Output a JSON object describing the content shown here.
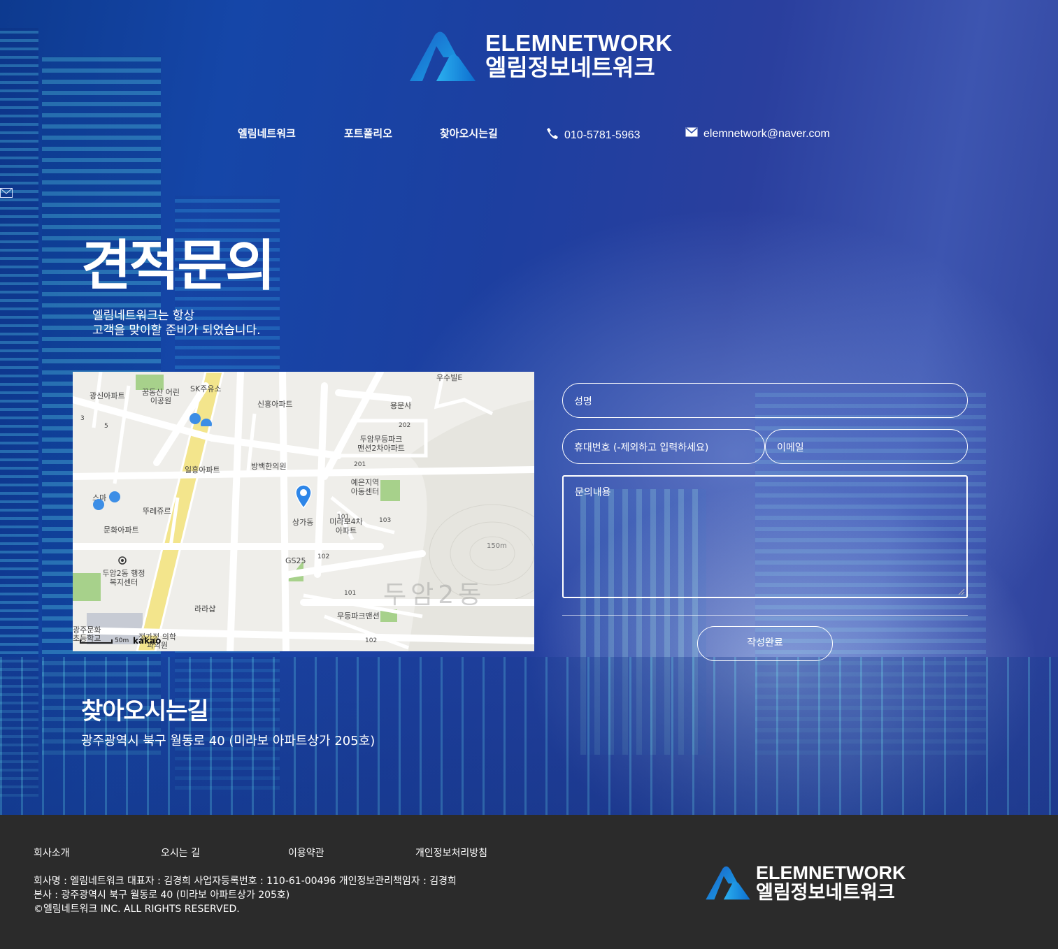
{
  "brand": {
    "name_en": "ELEMNETWORK",
    "name_ko": "엘림정보네트워크"
  },
  "nav": {
    "items": [
      "엘림네트워크",
      "포트폴리오",
      "찾아오시는길"
    ],
    "phone": "010-5781-5963",
    "email": "elemnetwork@naver.com"
  },
  "hero": {
    "title": "견적문의",
    "subtitle_line1": "엘림네트워크는 항상",
    "subtitle_line2": "고객을 맞이할 준비가 되었습니다."
  },
  "map": {
    "labels": [
      "광신아파트",
      "꿈동산 어린이공원",
      "SK주유소",
      "신흥아파트",
      "우수빌E",
      "용문사",
      "두암무등파크 맨션2차아파트",
      "일흥아파트",
      "방백한의원",
      "예은지역 아동센터",
      "상가동",
      "미라보4차 아파트",
      "스마",
      "뚜레쥬르",
      "문화아파트",
      "GS25",
      "두암2동 행정복지센터",
      "라라샵",
      "무등파크맨션",
      "정가정 의학과의원",
      "광주문화 초등학교",
      "150m",
      "50m",
      "kakao"
    ],
    "area_name": "두암2동",
    "numbers": [
      "3",
      "5",
      "202",
      "201",
      "101",
      "103",
      "102",
      "101",
      "102"
    ]
  },
  "form": {
    "name_placeholder": "성명",
    "phone_placeholder": "휴대번호 (-제외하고 입력하세요)",
    "email_placeholder": "이메일",
    "message_placeholder": "문의내용",
    "submit_label": "작성완료"
  },
  "directions": {
    "title": "찾아오시는길",
    "address": "광주광역시 북구 월동로 40 (미라보 아파트상가 205호)"
  },
  "footer": {
    "links": [
      "회사소개",
      "오시는 길",
      "이용약관",
      "개인정보처리방침"
    ],
    "company_line": "회사명 : 엘림네트워크 대표자 : 김경희 사업자등록번호 : 110-61-00496 개인정보관리책임자 : 김경희",
    "address_line": "본사 : 광주광역시 북구 월동로 40 (미라보 아파트상가 205호)",
    "copyright": "©엘림네트워크 INC. ALL RIGHTS RESERVED."
  },
  "colors": {
    "accent": "#1e8de0",
    "footer_bg": "#2b2b2b",
    "map_bg": "#efeeea"
  }
}
